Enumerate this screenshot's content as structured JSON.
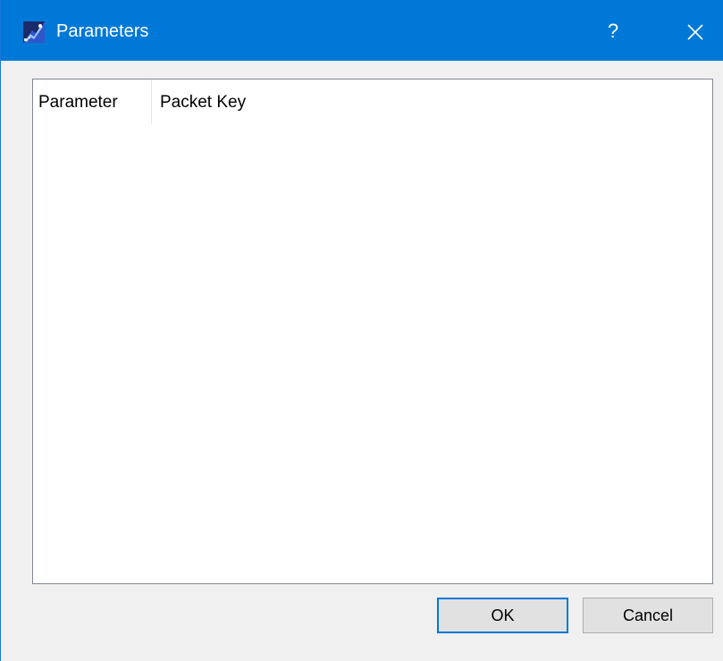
{
  "window": {
    "title": "Parameters",
    "help_label": "?",
    "icon": "app-icon",
    "titlebar_color": "#0078d7"
  },
  "table": {
    "columns": [
      {
        "label": "Parameter"
      },
      {
        "label": "Packet Key"
      }
    ],
    "rows": []
  },
  "buttons": {
    "ok_label": "OK",
    "cancel_label": "Cancel"
  }
}
